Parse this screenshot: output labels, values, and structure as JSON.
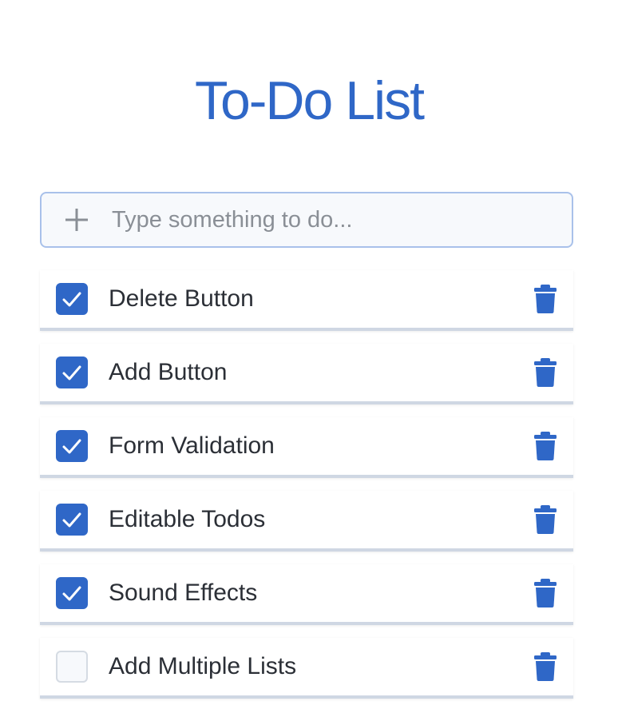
{
  "header": {
    "title": "To-Do List"
  },
  "add_form": {
    "placeholder": "Type something to do...",
    "value": "",
    "icon": "plus-icon"
  },
  "todos": [
    {
      "label": "Delete Button",
      "done": true
    },
    {
      "label": "Add Button",
      "done": true
    },
    {
      "label": "Form Validation",
      "done": true
    },
    {
      "label": "Editable Todos",
      "done": true
    },
    {
      "label": "Sound Effects",
      "done": true
    },
    {
      "label": "Add Multiple Lists",
      "done": false
    }
  ],
  "icons": {
    "checkbox": "checkmark-icon",
    "delete": "trash-icon"
  },
  "colors": {
    "accent": "#2f67c7",
    "input_border": "#a9c1ea",
    "input_bg": "#f7f9fc",
    "item_border": "#cfd7e3",
    "text": "#2b2f36",
    "placeholder": "#8a8f96"
  }
}
